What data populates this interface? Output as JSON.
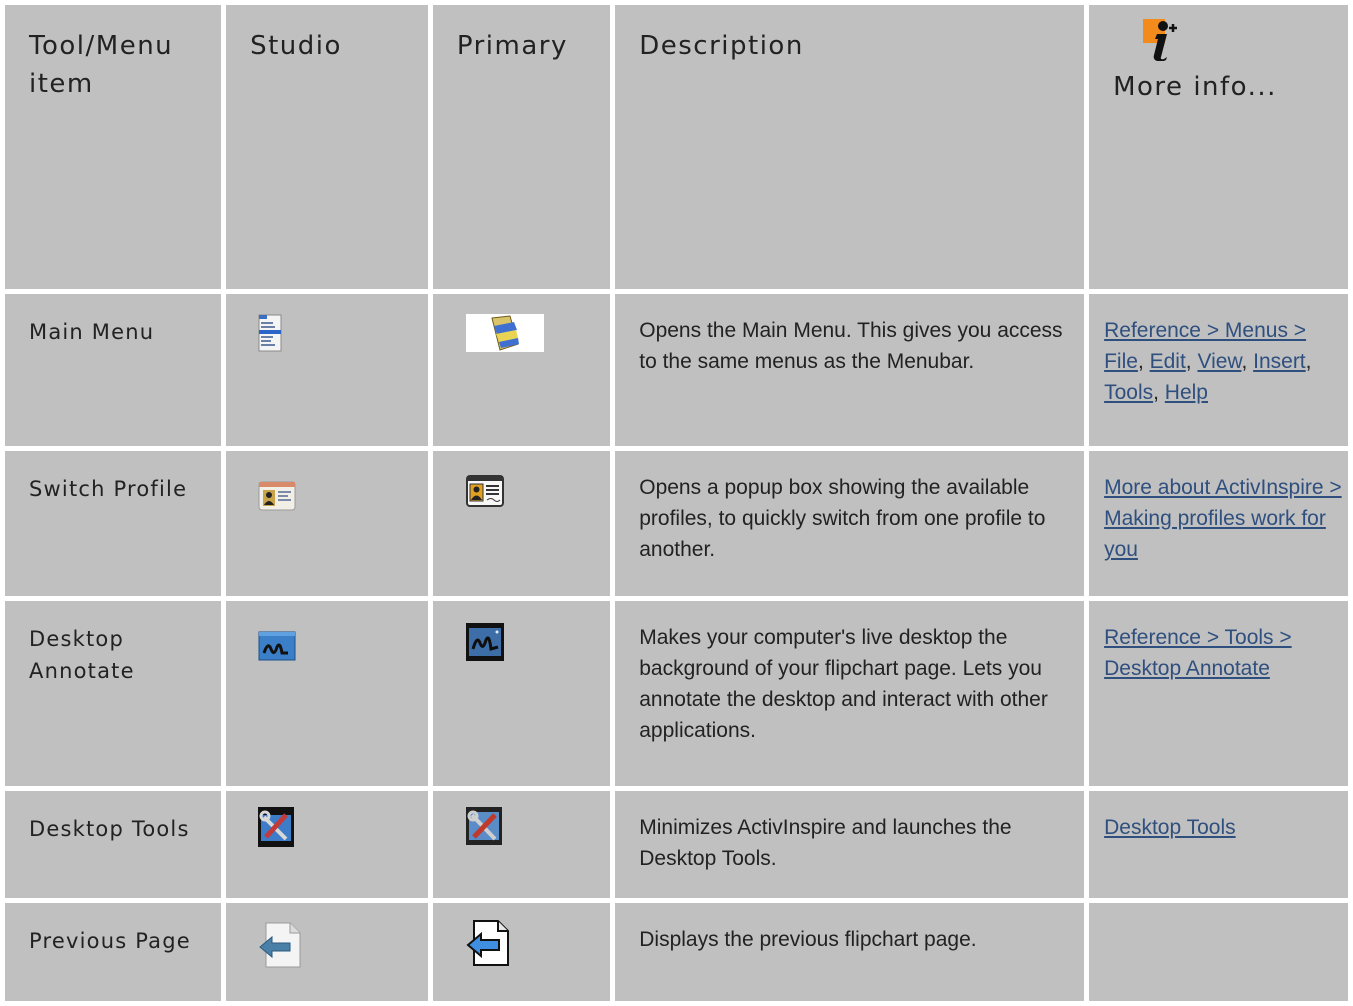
{
  "header": {
    "tool": "Tool/Menu item",
    "studio": "Studio",
    "primary": "Primary",
    "description": "Description",
    "more_info": "More info...",
    "more_info_icon": "info-plus-icon",
    "accent_color": "#f28a1c"
  },
  "rows": [
    {
      "name": "Main Menu",
      "studio_icon": "main-menu-list-icon",
      "primary_icon": "main-menu-folder-icon",
      "description": "Opens the Main Menu. This gives you access to the same menus as the Menubar.",
      "links": [
        "Reference > Menus > File",
        "Edit",
        "View",
        "Insert",
        "Tools",
        "Help"
      ],
      "link_separator": ", "
    },
    {
      "name": "Switch Profile",
      "studio_icon": "profile-card-icon",
      "primary_icon": "profile-card-icon",
      "description": "Opens a popup box showing the available profiles, to quickly switch from one profile to another.",
      "links": [
        "More about ActivInspire > Making profiles work for you"
      ]
    },
    {
      "name": "Desktop Annotate",
      "studio_icon": "desktop-annotate-pen-icon",
      "primary_icon": "desktop-annotate-pen-icon",
      "description": "Makes your computer's live desktop the background of your flipchart page. Lets you annotate the desktop and interact with other applications.",
      "links": [
        "Reference > Tools > Desktop Annotate"
      ]
    },
    {
      "name": "Desktop Tools",
      "studio_icon": "desktop-tools-wrench-icon",
      "primary_icon": "desktop-tools-wrench-icon",
      "description": "Minimizes ActivInspire and launches the Desktop Tools.",
      "links": [
        "Desktop Tools"
      ]
    },
    {
      "name": "Previous Page",
      "studio_icon": "previous-page-arrow-icon",
      "primary_icon": "previous-page-arrow-icon",
      "description": "Displays the previous flipchart page.",
      "links": []
    }
  ],
  "colors": {
    "cell_background": "#c0c0c0",
    "link": "#2f4f7f",
    "text": "#222222"
  }
}
